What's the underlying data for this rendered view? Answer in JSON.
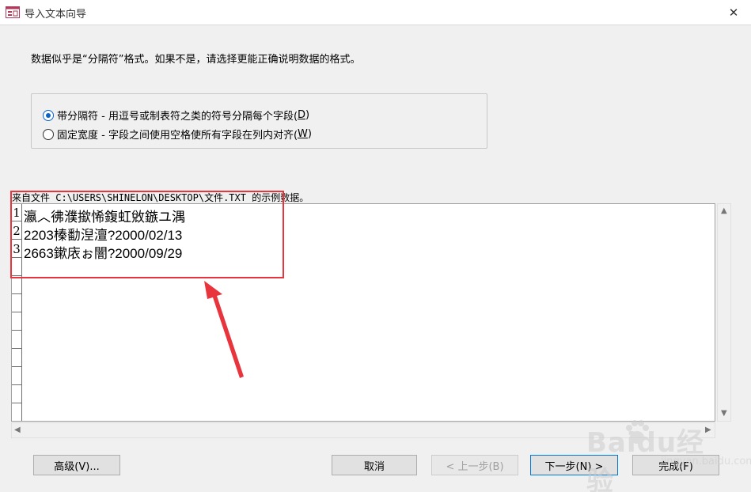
{
  "window": {
    "title": "导入文本向导",
    "close": "✕"
  },
  "prompt": "数据似乎是“分隔符”格式。如果不是，请选择更能正确说明数据的格式。",
  "options": [
    {
      "text": "带分隔符 - 用逗号或制表符之类的符号分隔每个字段(",
      "key": "D",
      "end": ")",
      "checked": true
    },
    {
      "text": "固定宽度 - 字段之间使用空格使所有字段在列内对齐(",
      "key": "W",
      "end": ")",
      "checked": false
    }
  ],
  "sample_label": "来自文件 C:\\USERS\\SHINELON\\DESKTOP\\文件.TXT 的示例数据。",
  "rows": [
    {
      "num": "1",
      "text": "瀛︿彿濮撳悕鍑虹敓鏃ユ湡"
    },
    {
      "num": "2",
      "text": "2203榛勫湼澶?2000/02/13"
    },
    {
      "num": "3",
      "text": "2663鏉庡ぉ闇?2000/09/29"
    }
  ],
  "buttons": {
    "advanced": "高级(V)...",
    "cancel": "取消",
    "back": "< 上一步(B)",
    "next": "下一步(N) >",
    "finish": "完成(F)"
  },
  "watermark": {
    "brand": "Baidu经验",
    "sub": "jingyan.baidu.com"
  },
  "colors": {
    "highlight": "#e8353d",
    "accent": "#0078d7"
  }
}
